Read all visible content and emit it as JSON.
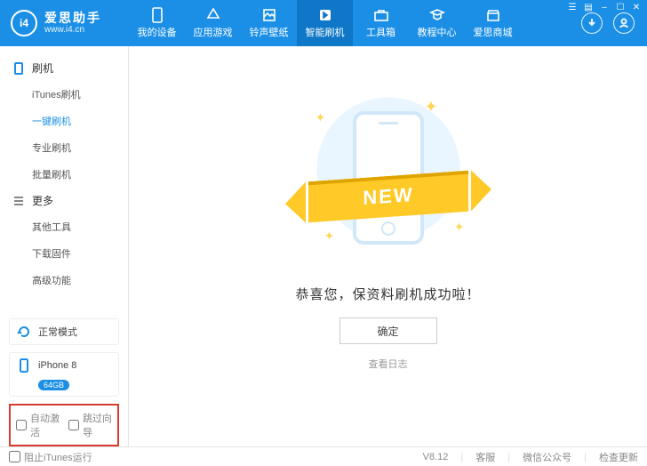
{
  "brand": {
    "logo_initials": "i4",
    "name": "爱思助手",
    "url": "www.i4.cn"
  },
  "nav": [
    {
      "label": "我的设备"
    },
    {
      "label": "应用游戏"
    },
    {
      "label": "铃声壁纸"
    },
    {
      "label": "智能刷机"
    },
    {
      "label": "工具箱"
    },
    {
      "label": "教程中心"
    },
    {
      "label": "爱思商城"
    }
  ],
  "nav_active_index": 3,
  "sidebar": {
    "group1_label": "刷机",
    "group1_items": [
      "iTunes刷机",
      "一键刷机",
      "专业刷机",
      "批量刷机"
    ],
    "group1_active_index": 1,
    "group2_label": "更多",
    "group2_items": [
      "其他工具",
      "下载固件",
      "高级功能"
    ],
    "mode_label": "正常模式",
    "device_name": "iPhone 8",
    "device_capacity": "64GB",
    "option_auto_activate": "自动激活",
    "option_skip_guide": "跳过向导"
  },
  "main": {
    "ribbon_text": "NEW",
    "success_message": "恭喜您，保资料刷机成功啦！",
    "ok_button": "确定",
    "view_log": "查看日志"
  },
  "footer": {
    "block_itunes": "阻止iTunes运行",
    "version": "V8.12",
    "support": "客服",
    "wechat": "微信公众号",
    "check_update": "检查更新"
  }
}
